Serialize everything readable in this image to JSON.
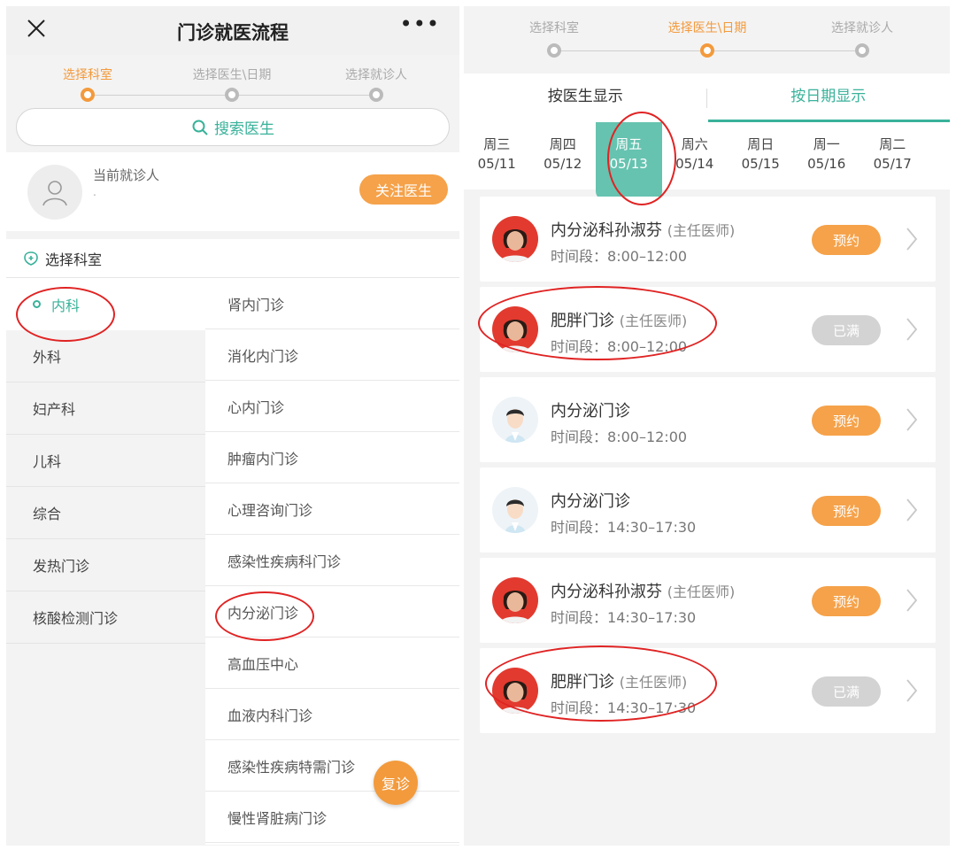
{
  "left": {
    "topbar": {
      "title": "门诊就医流程",
      "more": "•••"
    },
    "steps": [
      "选择科室",
      "选择医生\\日期",
      "选择就诊人"
    ],
    "search_label": "搜索医生",
    "patient": {
      "label": "当前就诊人",
      "value": "."
    },
    "follow_button": "关注医生",
    "section_title": "选择科室",
    "departments": [
      "内科",
      "外科",
      "妇产科",
      "儿科",
      "综合",
      "发热门诊",
      "核酸检测门诊"
    ],
    "sub_departments": [
      "肾内门诊",
      "消化内门诊",
      "心内门诊",
      "肿瘤内门诊",
      "心理咨询门诊",
      "感染性疾病科门诊",
      "内分泌门诊",
      "高血压中心",
      "血液内科门诊",
      "感染性疾病特需门诊",
      "慢性肾脏病门诊"
    ],
    "fuzhen": "复诊"
  },
  "right": {
    "steps": [
      "选择科室",
      "选择医生\\日期",
      "选择就诊人"
    ],
    "tabs": [
      "按医生显示",
      "按日期显示"
    ],
    "days": [
      {
        "week": "周三",
        "date": "05/11"
      },
      {
        "week": "周四",
        "date": "05/12"
      },
      {
        "week": "周五",
        "date": "05/13"
      },
      {
        "week": "周六",
        "date": "05/14"
      },
      {
        "week": "周日",
        "date": "05/15"
      },
      {
        "week": "周一",
        "date": "05/16"
      },
      {
        "week": "周二",
        "date": "05/17"
      }
    ],
    "time_prefix": "时间段：",
    "doctors": [
      {
        "name": "内分泌科孙淑芬",
        "rank": "(主任医师)",
        "time": "8:00–12:00",
        "status": "预约"
      },
      {
        "name": "肥胖门诊",
        "rank": "(主任医师)",
        "time": "8:00–12:00",
        "status": "已满"
      },
      {
        "name": "内分泌门诊",
        "rank": "",
        "time": "8:00–12:00",
        "status": "预约"
      },
      {
        "name": "内分泌门诊",
        "rank": "",
        "time": "14:30–17:30",
        "status": "预约"
      },
      {
        "name": "内分泌科孙淑芬",
        "rank": "(主任医师)",
        "time": "14:30–17:30",
        "status": "预约"
      },
      {
        "name": "肥胖门诊",
        "rank": "(主任医师)",
        "time": "14:30–17:30",
        "status": "已满"
      }
    ]
  },
  "colors": {
    "accent_teal": "#39b29a",
    "accent_orange": "#f39a3c",
    "annotation_red": "#e02323"
  }
}
